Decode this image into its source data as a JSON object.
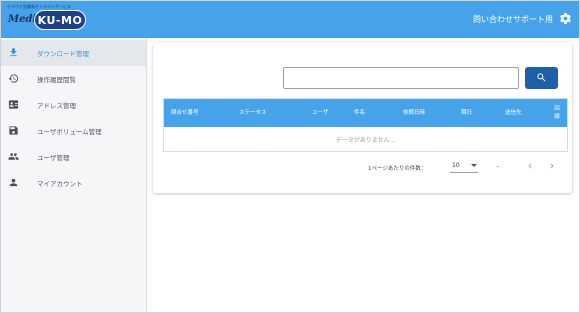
{
  "header": {
    "logo_tagline": "クラウド型最新オンラインサービス",
    "logo_prefix": "Media",
    "logo_name": "KU-MO",
    "support_link": "問い合わせサポート用",
    "settings_icon": "gear-icon",
    "accent_color": "#46a3ea"
  },
  "sidebar": {
    "items": [
      {
        "label": "ダウンロード管理",
        "icon": "download-icon",
        "active": true
      },
      {
        "label": "操作履歴閲覧",
        "icon": "history-icon",
        "active": false
      },
      {
        "label": "アドレス管理",
        "icon": "contact-card-icon",
        "active": false
      },
      {
        "label": "ユーザボリューム管理",
        "icon": "save-icon",
        "active": false
      },
      {
        "label": "ユーザ管理",
        "icon": "people-icon",
        "active": false
      },
      {
        "label": "マイアカウント",
        "icon": "person-icon",
        "active": false
      }
    ]
  },
  "main": {
    "search": {
      "value": "",
      "placeholder": "",
      "button_color": "#1f5fa8"
    },
    "table": {
      "columns": [
        "問合せ番号",
        "ステータス",
        "ユーザ",
        "件名",
        "依頼日時",
        "期日",
        "送信先",
        "回線"
      ],
      "empty_message": "データがありません..."
    },
    "pagination": {
      "per_page_label": "1ページあたりの件数：",
      "per_page_value": "10",
      "range_text": "-"
    }
  }
}
